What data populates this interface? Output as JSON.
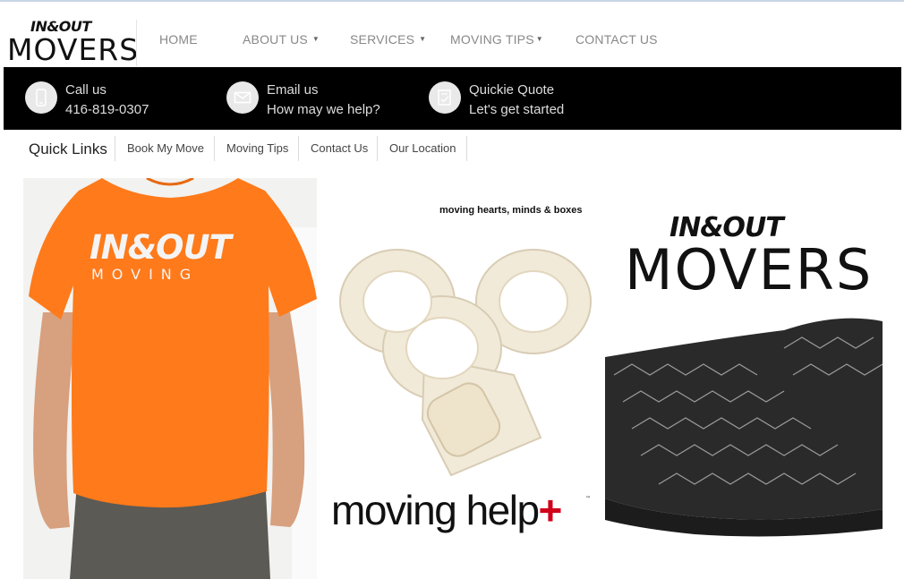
{
  "header": {
    "logo": {
      "top": "IN&OUT",
      "bottom": "MOVERS"
    },
    "nav": [
      {
        "label": "HOME",
        "dropdown": false
      },
      {
        "label": "ABOUT US",
        "dropdown": true
      },
      {
        "label": "SERVICES",
        "dropdown": true
      },
      {
        "label": "MOVING TIPS",
        "dropdown": true
      },
      {
        "label": "CONTACT US",
        "dropdown": false
      }
    ]
  },
  "contact_bar": {
    "items": [
      {
        "icon": "phone-icon",
        "line1": "Call us",
        "line2": "416-819-0307"
      },
      {
        "icon": "envelope-icon",
        "line1": "Email us",
        "line2": "How may we help?"
      },
      {
        "icon": "quote-form-icon",
        "line1": "Quickie Quote",
        "line2": "Let's get started"
      }
    ]
  },
  "quick_links": {
    "title": "Quick Links",
    "links": [
      "Book My Move",
      "Moving Tips",
      "Contact Us",
      "Our Location"
    ]
  },
  "panels": {
    "shirt": {
      "logo_top": "IN&OUT",
      "logo_bottom": "MOVING"
    },
    "tape": {
      "tagline": "moving hearts, minds & boxes",
      "headline": "moving help",
      "plus": "+",
      "tm": "™"
    },
    "blanket": {
      "logo_top": "IN&OUT",
      "logo_bottom": "MOVERS"
    }
  },
  "colors": {
    "accent_red": "#d0021b",
    "shirt_orange": "#ff7a1a",
    "bar_black": "#000000"
  }
}
